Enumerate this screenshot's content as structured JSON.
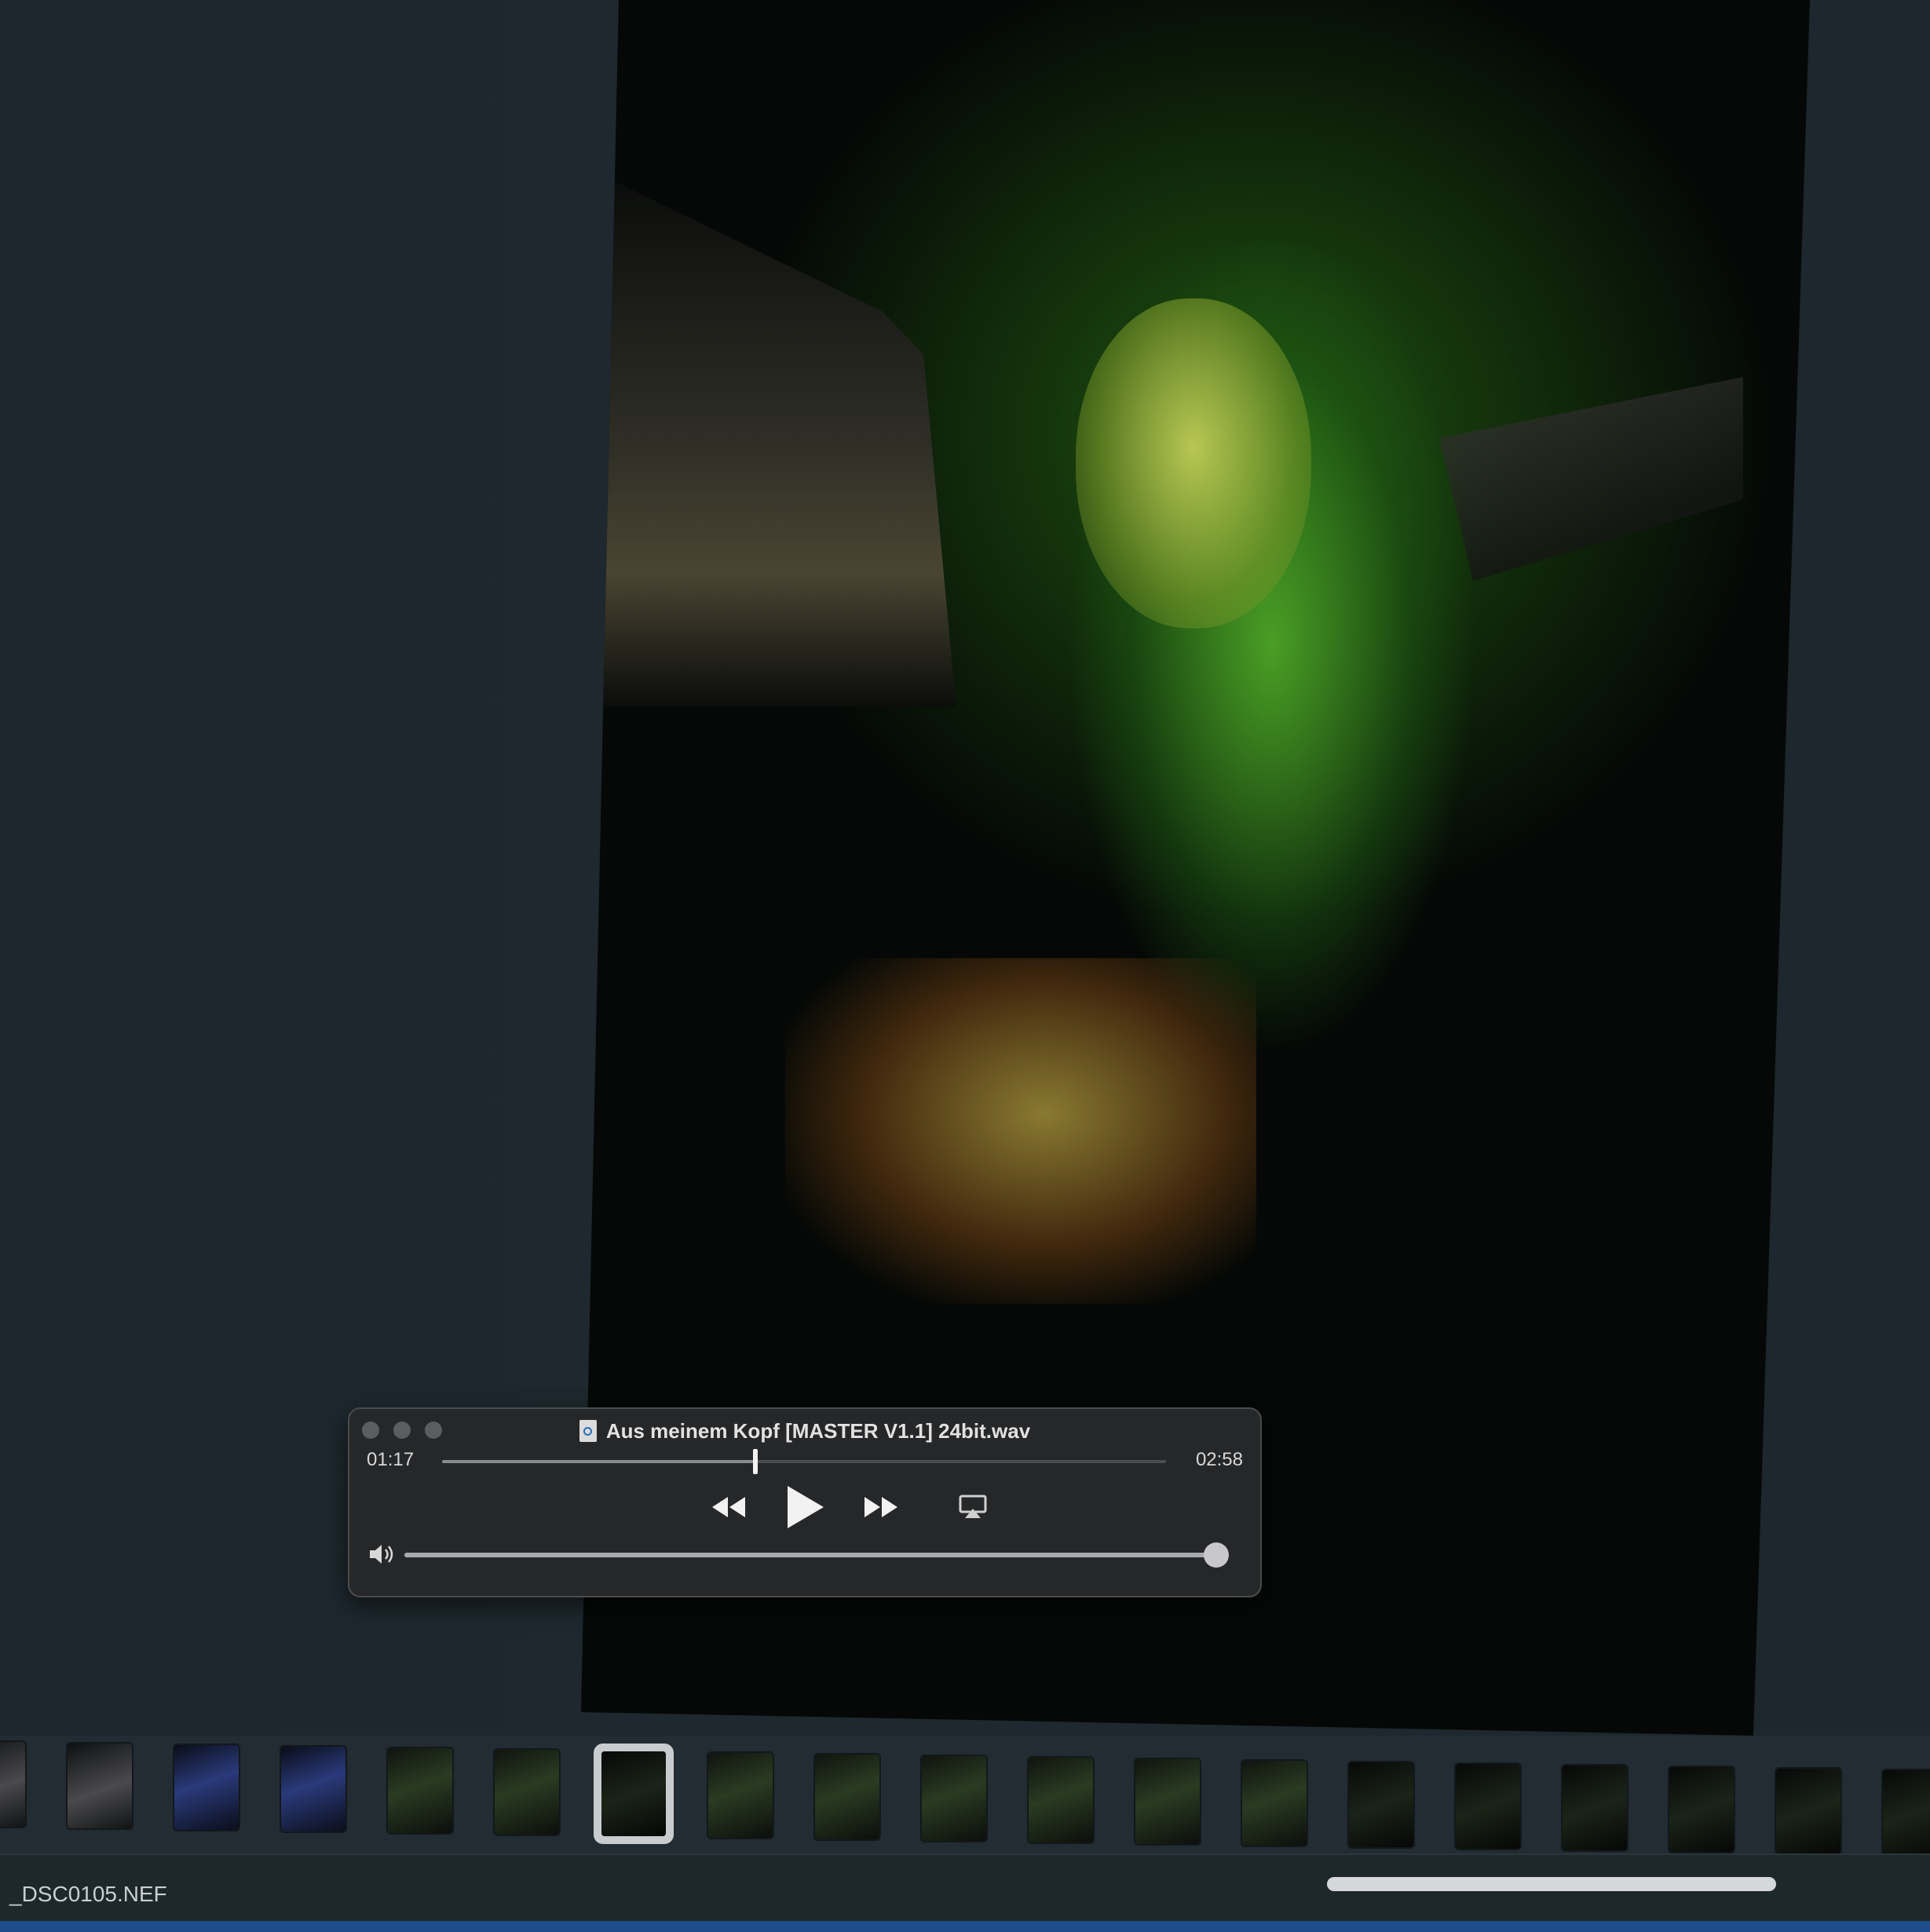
{
  "player": {
    "title": "Aus meinem Kopf [MASTER V1.1] 24bit.wav",
    "elapsed": "01:17",
    "duration": "02:58",
    "progress_fraction": 0.433,
    "volume_fraction": 1.0,
    "icons": {
      "file": "audio-file-icon",
      "rewind": "rewind-icon",
      "play": "play-icon",
      "forward": "fast-forward-icon",
      "airplay": "airplay-icon",
      "volume": "speaker-volume-icon"
    }
  },
  "browser": {
    "filename": "_DSC0105.NEF",
    "selected_thumbnail_index": 6,
    "thumbnail_count": 19
  },
  "colors": {
    "player_bg": "#262729",
    "workspace_bg": "#1c262c",
    "selection": "#c9ccce"
  }
}
